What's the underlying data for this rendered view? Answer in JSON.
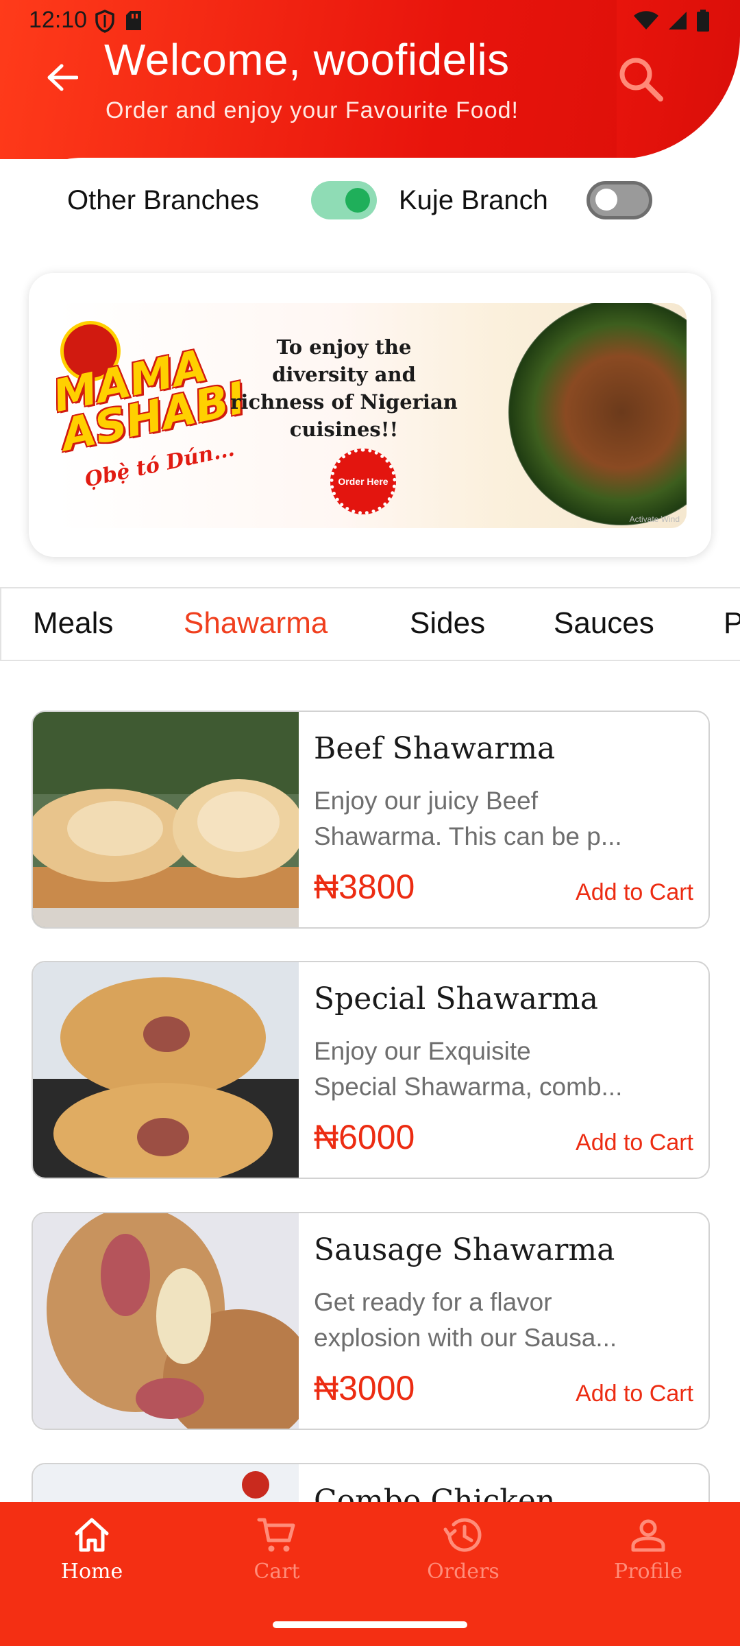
{
  "status_bar": {
    "time": "12:10"
  },
  "header": {
    "title": "Welcome, woofidelis",
    "subtitle": "Order and enjoy your Favourite Food!"
  },
  "branches": {
    "other_label": "Other Branches",
    "other_on": true,
    "kuje_label": "Kuje Branch",
    "kuje_on": false,
    "toggle_on_color": "#1faf5a",
    "toggle_on_track": "#8fdcb5"
  },
  "banner": {
    "brand_word_1": "MAMA",
    "brand_word_2": "ASHABI",
    "brand_tagline": "Ọbẹ̀ tó Dún...",
    "headline": "To enjoy the diversity and richness of Nigerian cuisines!!",
    "badge_text": "Order Here",
    "watermark": "Activate Wind"
  },
  "tabs": [
    {
      "label": "Meals",
      "active": false
    },
    {
      "label": "Shawarma",
      "active": true
    },
    {
      "label": "Sides",
      "active": false
    },
    {
      "label": "Sauces",
      "active": false
    },
    {
      "label": "P",
      "active": false
    }
  ],
  "products": [
    {
      "name": "Beef Shawarma",
      "desc_line1": "Enjoy our juicy Beef",
      "desc_line2": "Shawarma. This can be p...",
      "price": "₦3800",
      "action": "Add to Cart"
    },
    {
      "name": "Special Shawarma",
      "desc_line1": "Enjoy our Exquisite",
      "desc_line2": "Special Shawarma, comb...",
      "price": "₦6000",
      "action": "Add to Cart"
    },
    {
      "name": "Sausage Shawarma",
      "desc_line1": "Get ready for a flavor",
      "desc_line2": "explosion with our Sausa...",
      "price": "₦3000",
      "action": "Add to Cart"
    },
    {
      "name": "Combo Chicken",
      "desc_line1": "",
      "desc_line2": "",
      "price": "",
      "action": ""
    }
  ],
  "bottom_nav": [
    {
      "label": "Home",
      "icon": "home-icon",
      "active": true
    },
    {
      "label": "Cart",
      "icon": "cart-icon",
      "active": false
    },
    {
      "label": "Orders",
      "icon": "history-icon",
      "active": false
    },
    {
      "label": "Profile",
      "icon": "person-icon",
      "active": false
    }
  ],
  "colors": {
    "accent": "#f42f13",
    "price": "#ec2c12",
    "active_tab": "#f03f1e"
  }
}
